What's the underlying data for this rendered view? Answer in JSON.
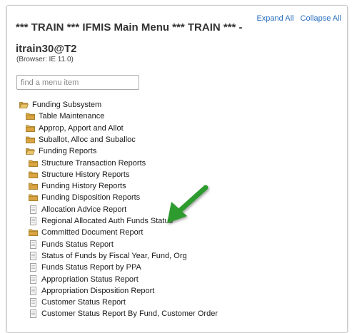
{
  "header": {
    "title": "*** TRAIN *** IFMIS Main Menu *** TRAIN *** - itrain30@T2",
    "expand_all": "Expand All",
    "collapse_all": "Collapse All",
    "browser": "(Browser: IE 11.0)"
  },
  "search": {
    "placeholder": "find a menu item"
  },
  "tree": [
    {
      "label": "Funding Subsystem",
      "icon": "folder-open-icon",
      "level": 0
    },
    {
      "label": "Table Maintenance",
      "icon": "folder-icon",
      "level": 1
    },
    {
      "label": "Approp, Apport and Allot",
      "icon": "folder-icon",
      "level": 1
    },
    {
      "label": "Suballot, Alloc and Suballoc",
      "icon": "folder-icon",
      "level": 1
    },
    {
      "label": "Funding Reports",
      "icon": "folder-open-icon",
      "level": 1
    },
    {
      "label": "Structure Transaction Reports",
      "icon": "folder-icon",
      "level": 2
    },
    {
      "label": "Structure History Reports",
      "icon": "folder-icon",
      "level": 2
    },
    {
      "label": "Funding History Reports",
      "icon": "folder-icon",
      "level": 2
    },
    {
      "label": "Funding Disposition Reports",
      "icon": "folder-icon",
      "level": 2
    },
    {
      "label": "Allocation Advice Report",
      "icon": "document-icon",
      "level": 2
    },
    {
      "label": "Regional Allocated Auth Funds Status",
      "icon": "document-icon",
      "level": 2
    },
    {
      "label": "Committed Document Report",
      "icon": "folder-icon",
      "level": 2
    },
    {
      "label": "Funds Status Report",
      "icon": "document-icon",
      "level": 2
    },
    {
      "label": "Status of Funds by Fiscal Year, Fund, Org",
      "icon": "document-icon",
      "level": 2
    },
    {
      "label": "Funds Status Report by PPA",
      "icon": "document-icon",
      "level": 2
    },
    {
      "label": "Appropriation Status Report",
      "icon": "document-icon",
      "level": 2
    },
    {
      "label": "Appropriation Disposition Report",
      "icon": "document-icon",
      "level": 2
    },
    {
      "label": "Customer Status Report",
      "icon": "document-icon",
      "level": 2
    },
    {
      "label": "Customer Status Report By Fund, Customer Order",
      "icon": "document-icon",
      "level": 2
    }
  ],
  "colors": {
    "link": "#2a6fbf",
    "folder": "#d9a441",
    "arrow": "#2e9b2e"
  }
}
